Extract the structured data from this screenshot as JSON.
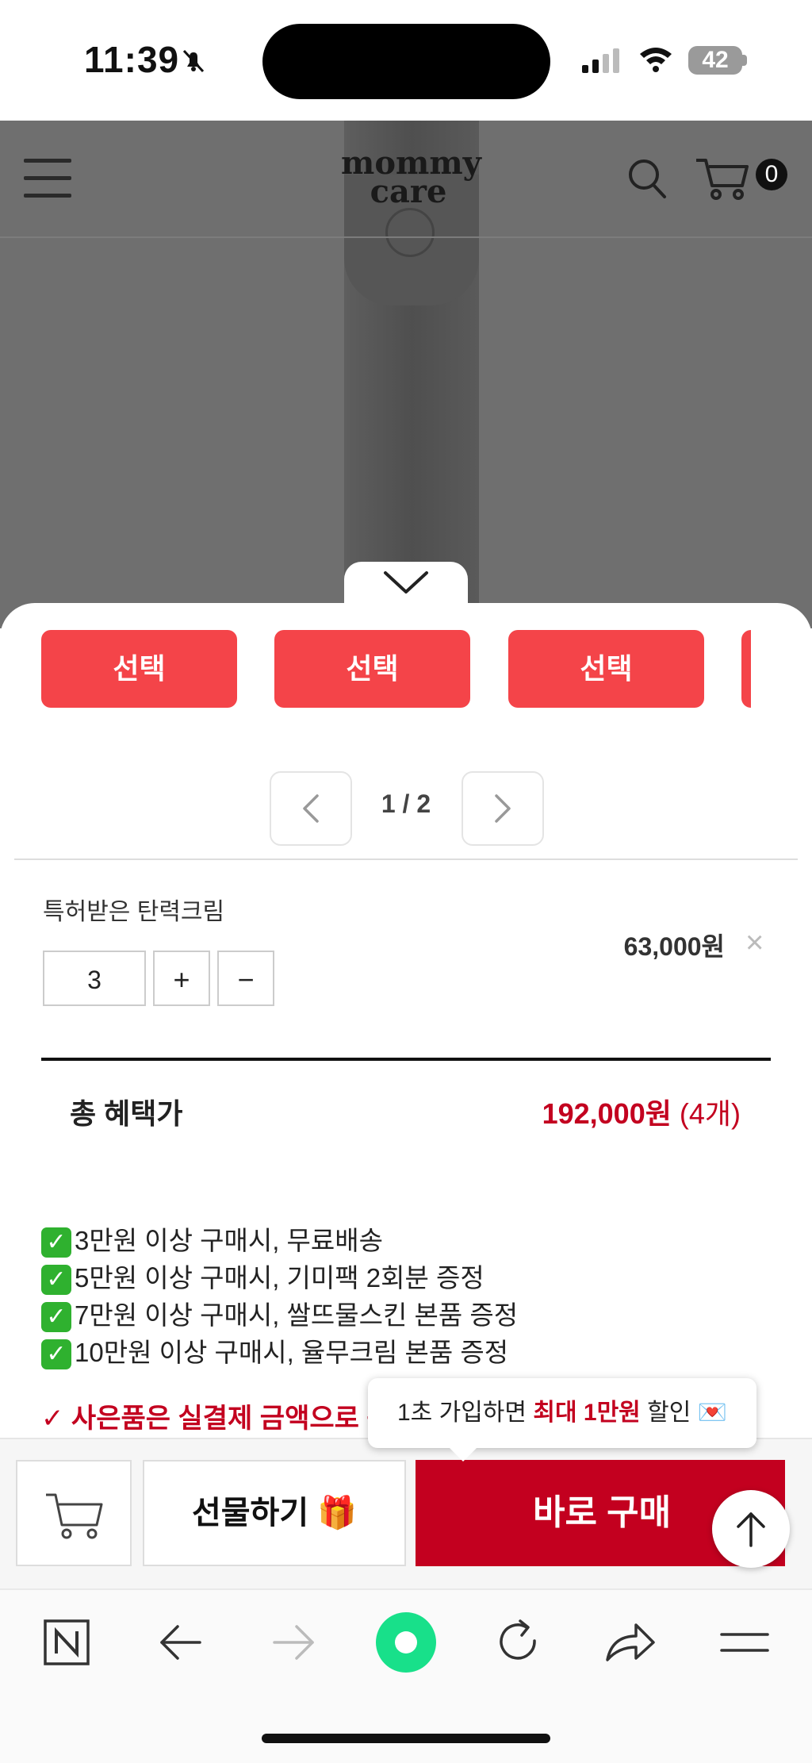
{
  "status_bar": {
    "time": "11:39",
    "battery": "42"
  },
  "header": {
    "logo_line1": "mommy",
    "logo_line2": "care",
    "cart_count": "0"
  },
  "options": {
    "select_label": "선택"
  },
  "pager": {
    "text": "1 / 2"
  },
  "cart_item": {
    "name": "특허받은 탄력크림",
    "quantity": "3",
    "plus": "+",
    "minus": "−",
    "price": "63,000원",
    "remove": "×"
  },
  "total": {
    "label": "총 혜택가",
    "price": "192,000원",
    "count": "(4개)"
  },
  "benefits": [
    "3만원 이상 구매시, 무료배송",
    "5만원 이상 구매시, 기미팩 2회분 증정",
    "7만원 이상 구매시, 쌀뜨물스킨 본품 증정",
    "10만원 이상 구매시, 율무크림 본품 증정"
  ],
  "notice": "✓ 사은품은 실결제 금액으로 증정됩니다",
  "tooltip": {
    "part1": "1초 가입하면 ",
    "highlight": "최대 1만원",
    "part2": " 할인 💌"
  },
  "actions": {
    "gift_label": "선물하기 🎁",
    "buy_label": "바로 구매"
  },
  "colors": {
    "accent_red": "#c3001f",
    "select_red": "#f44449"
  }
}
